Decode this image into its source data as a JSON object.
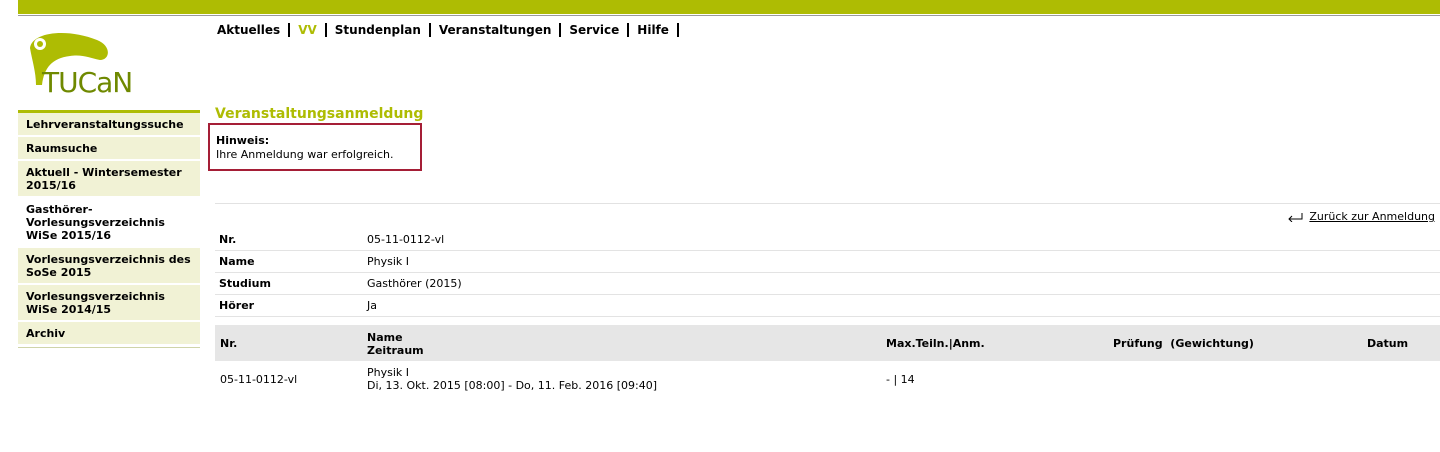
{
  "app": {
    "logo_text": "TUCaN"
  },
  "topnav": [
    {
      "label": "Aktuelles",
      "active": false
    },
    {
      "label": "VV",
      "active": true
    },
    {
      "label": "Stundenplan",
      "active": false
    },
    {
      "label": "Veranstaltungen",
      "active": false
    },
    {
      "label": "Service",
      "active": false
    },
    {
      "label": "Hilfe",
      "active": false
    }
  ],
  "sidebar": {
    "items": [
      {
        "label": "Lehrveranstaltungssuche"
      },
      {
        "label": "Raumsuche"
      },
      {
        "label": "Aktuell - Wintersemester 2015/16"
      },
      {
        "label": "Gasthörer-Vorlesungsverzeichnis WiSe 2015/16"
      },
      {
        "label": "Vorlesungsverzeichnis des SoSe 2015"
      },
      {
        "label": "Vorlesungsverzeichnis WiSe 2014/15"
      },
      {
        "label": "Archiv"
      }
    ]
  },
  "page": {
    "title": "Veranstaltungsanmeldung",
    "notice_title": "Hinweis:",
    "notice_text": "Ihre Anmeldung war erfolgreich.",
    "back_link": "Zurück zur Anmeldung"
  },
  "info": [
    {
      "key": "Nr.",
      "value": "05-11-0112-vl"
    },
    {
      "key": "Name",
      "value": "Physik I"
    },
    {
      "key": "Studium",
      "value": "Gasthörer (2015)"
    },
    {
      "key": "Hörer",
      "value": "Ja"
    }
  ],
  "table": {
    "headers": {
      "nr": "Nr.",
      "name": "Name",
      "zeitraum": "Zeitraum",
      "max": "Max.Teiln.|Anm.",
      "pruefung": "Prüfung  (Gewichtung)",
      "datum": "Datum"
    },
    "row": {
      "nr": "05-11-0112-vl",
      "name": "Physik I",
      "zeitraum": "Di, 13. Okt. 2015 [08:00] - Do, 11. Feb. 2016 [09:40]",
      "max": "- | 14"
    }
  },
  "colors": {
    "accent": "#aebc03",
    "notice_border": "#a51e36",
    "sidebar_bg": "#f1f2d5"
  }
}
